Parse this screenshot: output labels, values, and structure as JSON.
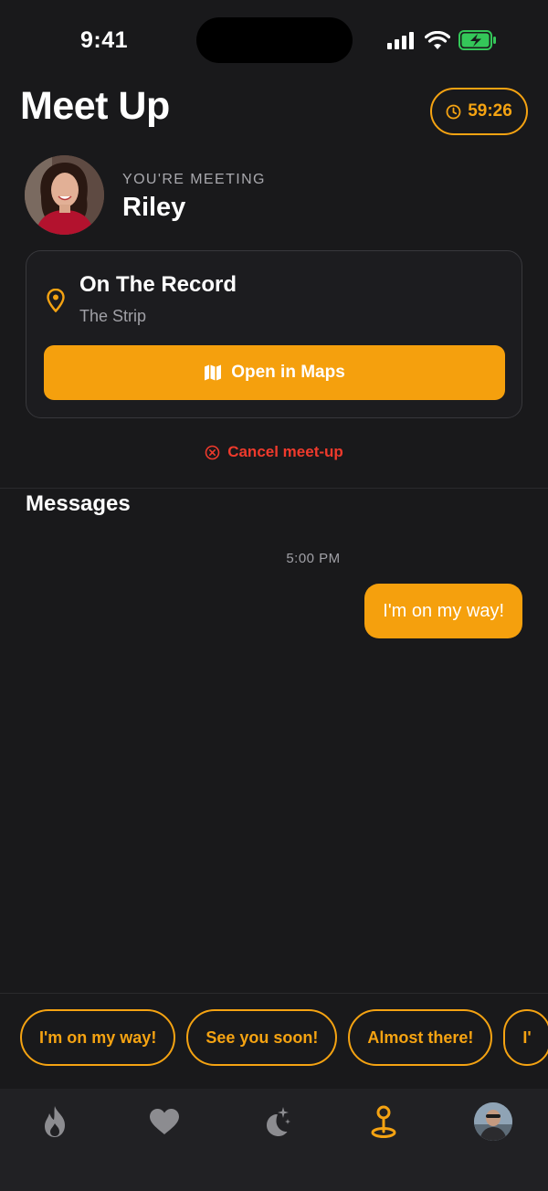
{
  "status_bar": {
    "time": "9:41"
  },
  "header": {
    "title": "Meet Up",
    "timer": "59:26"
  },
  "meeting": {
    "eyebrow": "YOU'RE MEETING",
    "name": "Riley"
  },
  "location": {
    "name": "On The Record",
    "area": "The Strip",
    "maps_button": "Open in Maps"
  },
  "cancel_label": "Cancel meet-up",
  "messages": {
    "title": "Messages",
    "timestamp": "5:00 PM",
    "items": [
      {
        "text": "I'm on my way!",
        "from": "me"
      }
    ]
  },
  "quick_replies": [
    "I'm on my way!",
    "See you soon!",
    "Almost there!",
    "I'"
  ],
  "tabbar": {
    "items": [
      {
        "icon": "flame-icon",
        "active": false
      },
      {
        "icon": "heart-icon",
        "active": false
      },
      {
        "icon": "moon-stars-icon",
        "active": false
      },
      {
        "icon": "meetup-pin-icon",
        "active": true
      },
      {
        "icon": "profile-avatar",
        "active": false
      }
    ]
  },
  "colors": {
    "accent": "#f5a00d",
    "danger": "#ef3a2c",
    "background": "#19191b",
    "battery": "#34c759"
  }
}
